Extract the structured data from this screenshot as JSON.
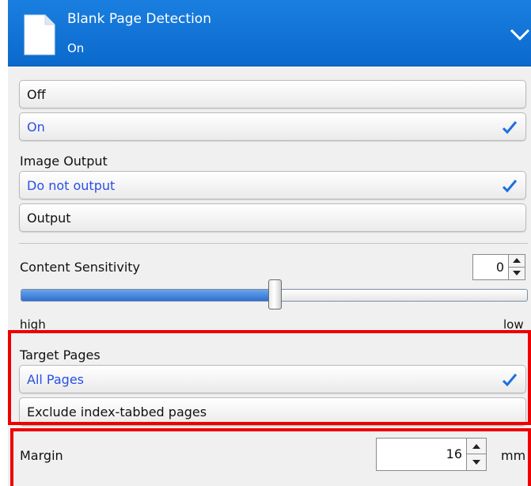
{
  "header": {
    "title": "Blank Page Detection",
    "value": "On",
    "icon": "document-icon",
    "collapse_icon": "chevron-down-icon",
    "color": "#0b69cc"
  },
  "detection_options": [
    {
      "label": "Off",
      "selected": false
    },
    {
      "label": "On",
      "selected": true
    }
  ],
  "image_output": {
    "label": "Image Output",
    "options": [
      {
        "label": "Do not output",
        "selected": true
      },
      {
        "label": "Output",
        "selected": false
      }
    ]
  },
  "content_sensitivity": {
    "label": "Content Sensitivity",
    "value": "0",
    "min_label": "high",
    "max_label": "low",
    "slider_fraction": 0.5
  },
  "target_pages": {
    "label": "Target Pages",
    "options": [
      {
        "label": "All Pages",
        "selected": true
      },
      {
        "label": "Exclude index-tabbed pages",
        "selected": false
      }
    ]
  },
  "margin": {
    "label": "Margin",
    "value": "16",
    "unit": "mm"
  },
  "colors": {
    "selected_text": "#2a4fe6",
    "checkmark": "#1e6fe0",
    "highlight": "#ee0000"
  }
}
